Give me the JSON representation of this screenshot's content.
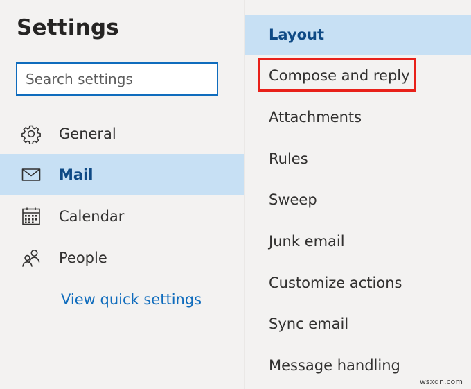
{
  "settings": {
    "title": "Settings",
    "search_placeholder": "Search settings"
  },
  "nav": {
    "items": [
      {
        "label": "General",
        "icon": "gear-icon"
      },
      {
        "label": "Mail",
        "icon": "envelope-icon",
        "active": true
      },
      {
        "label": "Calendar",
        "icon": "calendar-icon"
      },
      {
        "label": "People",
        "icon": "people-icon"
      }
    ],
    "quick_settings_link": "View quick settings"
  },
  "mail_settings": {
    "items": [
      {
        "label": "Layout",
        "active": true
      },
      {
        "label": "Compose and reply",
        "highlighted": true
      },
      {
        "label": "Attachments"
      },
      {
        "label": "Rules"
      },
      {
        "label": "Sweep"
      },
      {
        "label": "Junk email"
      },
      {
        "label": "Customize actions"
      },
      {
        "label": "Sync email"
      },
      {
        "label": "Message handling"
      }
    ]
  },
  "watermark": "wsxdn.com",
  "colors": {
    "accent": "#0f6cbd",
    "selected_bg": "#c7e0f4",
    "highlight_border": "#e8211a",
    "background": "#f3f2f1"
  }
}
